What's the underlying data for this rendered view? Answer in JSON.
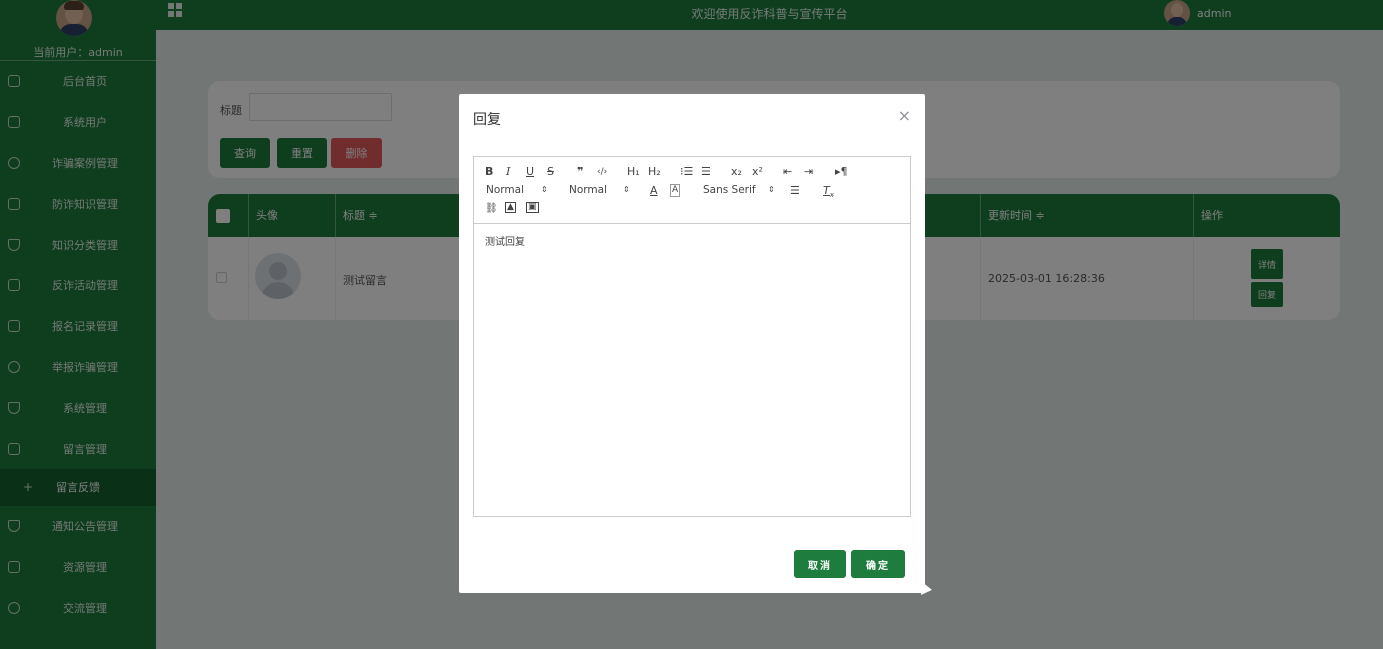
{
  "sidebar": {
    "current_user_label": "当前用户：admin",
    "items": [
      {
        "label": "后台首页",
        "icon": "home-icon"
      },
      {
        "label": "系统用户",
        "icon": "columns-icon"
      },
      {
        "label": "诈骗案例管理",
        "icon": "chat-icon"
      },
      {
        "label": "防诈知识管理",
        "icon": "document-icon"
      },
      {
        "label": "知识分类管理",
        "icon": "shield-icon"
      },
      {
        "label": "反诈活动管理",
        "icon": "columns-icon"
      },
      {
        "label": "报名记录管理",
        "icon": "document-icon"
      },
      {
        "label": "举报诈骗管理",
        "icon": "chat-icon"
      },
      {
        "label": "系统管理",
        "icon": "shield-icon"
      },
      {
        "label": "留言管理",
        "icon": "document-icon"
      }
    ],
    "sub_item": {
      "label": "留言反馈",
      "icon": "plus-icon"
    },
    "items_after": [
      {
        "label": "通知公告管理",
        "icon": "shield-icon"
      },
      {
        "label": "资源管理",
        "icon": "columns-icon"
      },
      {
        "label": "交流管理",
        "icon": "chat-icon"
      }
    ]
  },
  "topbar": {
    "welcome": "欢迎使用反诈科普与宣传平台",
    "user": "admin"
  },
  "search": {
    "label": "标题",
    "query_button": "查询",
    "reset_button": "重置",
    "delete_button": "删除"
  },
  "table": {
    "headers": {
      "avatar": "头像",
      "title": "标题 ≑",
      "updated": "更新时间 ≑",
      "actions": "操作"
    },
    "rows": [
      {
        "title": "测试留言",
        "updated": "2025-03-01 16:28:36",
        "detail_button": "详情",
        "reply_button": "回复"
      }
    ]
  },
  "modal": {
    "title": "回复",
    "close": "×",
    "toolbar": {
      "header_select": "Normal",
      "size_select": "Normal",
      "font_select": "Sans Serif"
    },
    "content": "测试回复",
    "cancel_button": "取消",
    "confirm_button": "确定"
  },
  "colors": {
    "brand_green": "#1e7d3e",
    "danger": "#e25a5a"
  }
}
